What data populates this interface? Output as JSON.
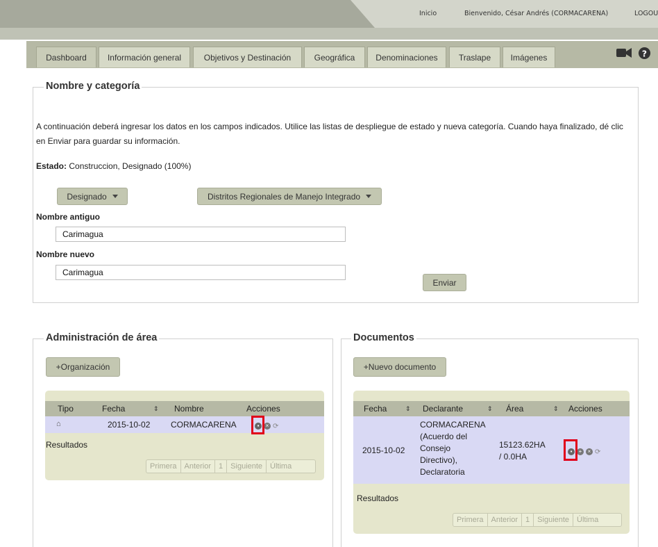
{
  "topnav": {
    "inicio": "Inicio",
    "welcome": "Bienvenido, César Andrés (CORMACARENA)",
    "logout": "LOGOUT"
  },
  "tabs": [
    "Dashboard",
    "Información general",
    "Objetivos y Destinación",
    "Geográfica",
    "Denominaciones",
    "Traslape",
    "Imágenes"
  ],
  "header_icons": {
    "video": "video-camera-icon",
    "help": "help-circle-icon"
  },
  "nombre_categoria": {
    "legend": "Nombre y categoría",
    "instructions": "A continuación deberá ingresar los datos en los campos indicados. Utilice las listas de despliegue de estado y nueva categoría. Cuando haya finalizado, dé clic en Enviar para guardar su información.",
    "estado_label": "Estado:",
    "estado_value": "Construccion, Designado (100%)",
    "status_dropdown": "Designado",
    "category_dropdown": "Distritos Regionales de Manejo Integrado",
    "old_name_label": "Nombre antiguo",
    "old_name_value": "Carimagua",
    "new_name_label": "Nombre nuevo",
    "new_name_value": "Carimagua",
    "submit": "Enviar"
  },
  "administracion": {
    "legend": "Administración de área",
    "add_button": "+Organización",
    "columns": [
      "Tipo",
      "Fecha",
      "Nombre",
      "Acciones"
    ],
    "rows": [
      {
        "tipo_icon": "home-icon",
        "fecha": "2015-10-02",
        "nombre": "CORMACARENA"
      }
    ],
    "results_label": "Resultados",
    "pager": [
      "Primera",
      "Anterior",
      "1",
      "Siguiente",
      "Última"
    ]
  },
  "documentos": {
    "legend": "Documentos",
    "add_button": "+Nuevo documento",
    "columns": [
      "Fecha",
      "Declarante",
      "Área",
      "Acciones"
    ],
    "rows": [
      {
        "fecha": "2015-10-02",
        "declarante": [
          "CORMACARENA",
          "(Acuerdo del",
          "Consejo",
          "Directivo),",
          "Declaratoria"
        ],
        "area": [
          "15123.62HA",
          "/ 0.0HA"
        ]
      }
    ],
    "results_label": "Resultados",
    "pager": [
      "Primera",
      "Anterior",
      "1",
      "Siguiente",
      "Última"
    ]
  },
  "colors": {
    "highlight": "#e0001a",
    "row_selected": "#d9d9f4",
    "tab_bar": "#b6b9a5"
  }
}
